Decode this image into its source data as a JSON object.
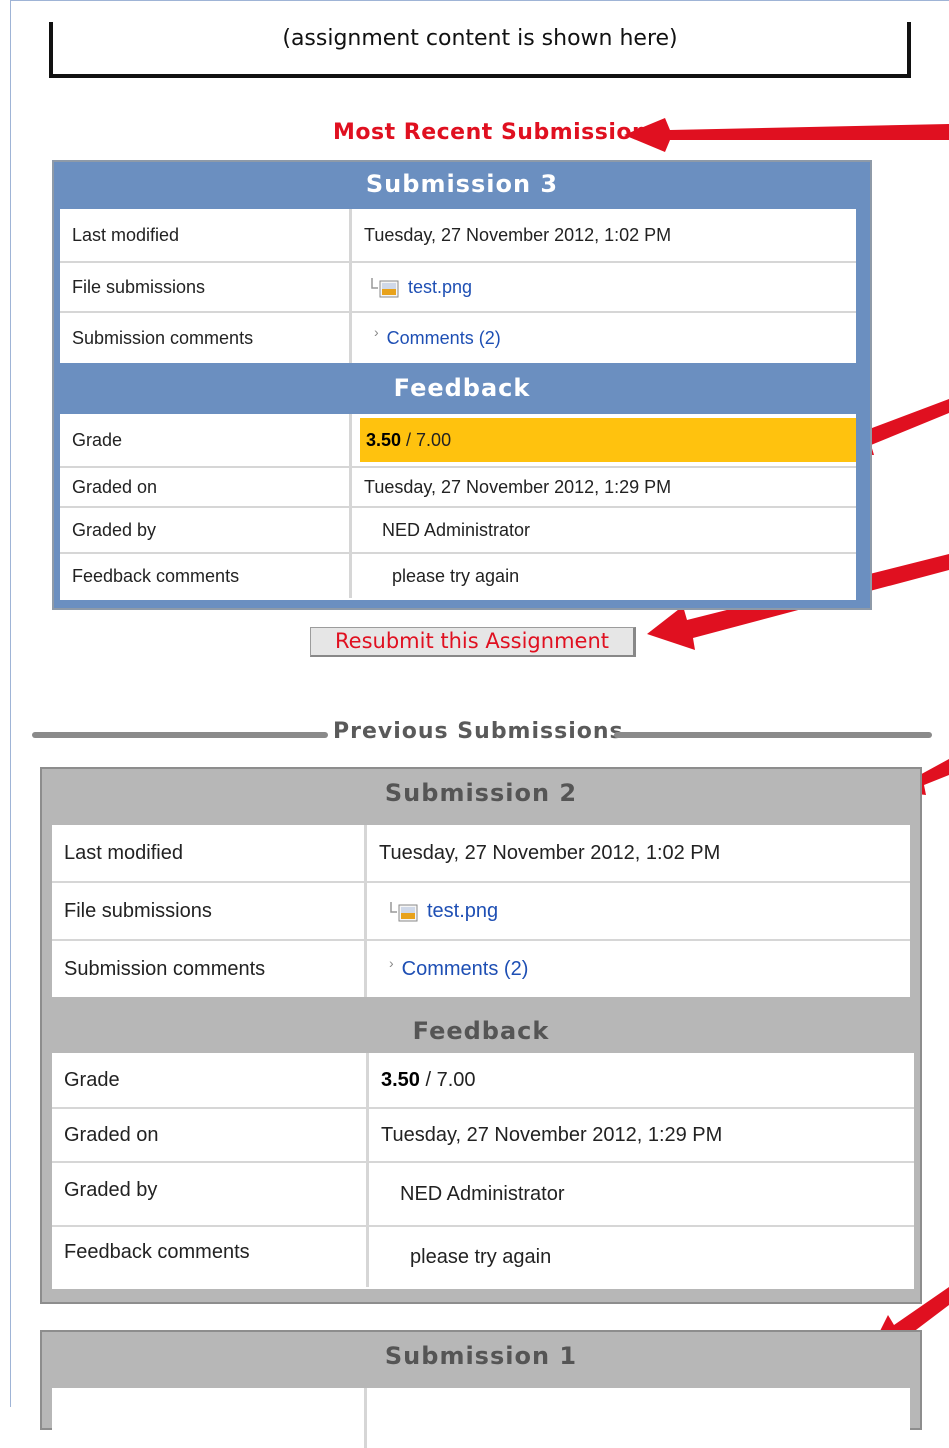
{
  "assignment_placeholder": "(assignment content is shown here)",
  "most_recent_label": "Most Recent Submission",
  "current_submission": {
    "title": "Submission 3",
    "rows": [
      {
        "label": "Last modified",
        "value": "Tuesday, 27 November 2012, 1:02 PM"
      },
      {
        "label": "File submissions",
        "value": "test.png"
      },
      {
        "label": "Submission comments",
        "value": "Comments (2)"
      }
    ],
    "feedback_title": "Feedback",
    "feedback_rows": [
      {
        "label": "Grade",
        "value_strong": "3.50",
        "value_rest": " / 7.00"
      },
      {
        "label": "Graded on",
        "value": "Tuesday, 27 November 2012, 1:29 PM"
      },
      {
        "label": "Graded by",
        "value": "NED Administrator"
      },
      {
        "label": "Feedback comments",
        "value": "please try again"
      }
    ]
  },
  "resubmit_label": "Resubmit this Assignment",
  "previous_label": "Previous Submissions",
  "previous_submissions": [
    {
      "title": "Submission 2",
      "rows": [
        {
          "label": "Last modified",
          "value": "Tuesday, 27 November 2012, 1:02 PM"
        },
        {
          "label": "File submissions",
          "value": "test.png"
        },
        {
          "label": "Submission comments",
          "value": "Comments (2)"
        }
      ],
      "feedback_title": "Feedback",
      "feedback_rows": [
        {
          "label": "Grade",
          "value_strong": "3.50",
          "value_rest": " / 7.00"
        },
        {
          "label": "Graded on",
          "value": "Tuesday, 27 November 2012, 1:29 PM"
        },
        {
          "label": "Graded by",
          "value": "NED Administrator"
        },
        {
          "label": "Feedback comments",
          "value": "please try again"
        }
      ]
    },
    {
      "title": "Submission 1"
    }
  ],
  "colors": {
    "annotation_red": "#e01020",
    "grade_highlight": "#ffc20e",
    "current_panel": "#6b8fc0",
    "previous_panel": "#b7b7b7",
    "link": "#1e4fb4"
  },
  "icons": [
    "file-image-icon",
    "chevron-right-icon",
    "annotation-arrow-icon"
  ]
}
